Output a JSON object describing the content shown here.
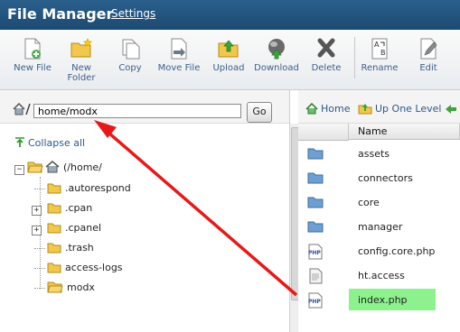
{
  "header": {
    "title": "File Manager",
    "settings": "Settings"
  },
  "toolbar": {
    "new_file": "New File",
    "new_folder_1": "New",
    "new_folder_2": "Folder",
    "copy": "Copy",
    "move_file": "Move File",
    "upload": "Upload",
    "download": "Download",
    "delete": "Delete",
    "rename": "Rename",
    "edit": "Edit"
  },
  "pathbar": {
    "path": "home/modx",
    "go": "Go"
  },
  "tree": {
    "collapse_all": "Collapse all",
    "root": "(/home/",
    "items": [
      ".autorespond",
      ".cpan",
      ".cpanel",
      ".trash",
      "access-logs",
      "modx"
    ]
  },
  "nav": {
    "home": "Home",
    "up": "Up One Level"
  },
  "table": {
    "name_header": "Name",
    "rows": [
      "assets",
      "connectors",
      "core",
      "manager",
      "config.core.php",
      "ht.access",
      "index.php"
    ]
  },
  "colors": {
    "header": "#1d4a72",
    "selected_row": "#8df28d",
    "arrow": "#e81818"
  }
}
